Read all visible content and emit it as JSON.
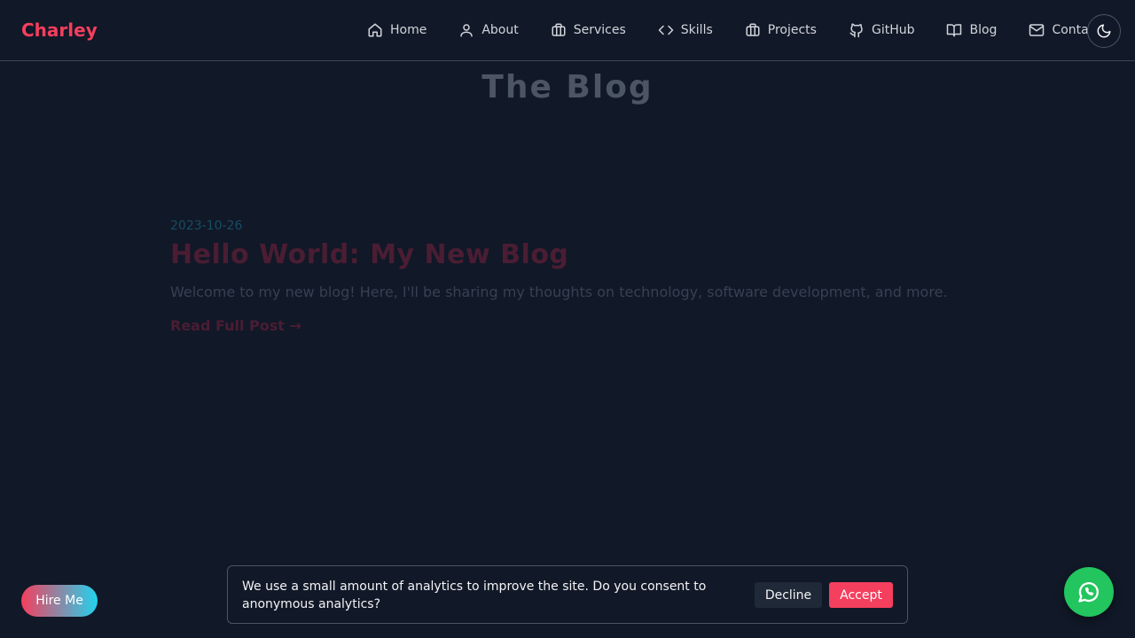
{
  "brand": "Charley",
  "nav": [
    {
      "label": "Home",
      "icon": "home-icon"
    },
    {
      "label": "About",
      "icon": "user-icon"
    },
    {
      "label": "Services",
      "icon": "briefcase-icon"
    },
    {
      "label": "Skills",
      "icon": "code-icon"
    },
    {
      "label": "Projects",
      "icon": "briefcase-icon"
    },
    {
      "label": "GitHub",
      "icon": "github-icon"
    },
    {
      "label": "Blog",
      "icon": "book-icon"
    },
    {
      "label": "Contact",
      "icon": "mail-icon"
    }
  ],
  "theme_toggle_icon": "moon-icon",
  "page_title": "The Blog",
  "post": {
    "date": "2023-10-26",
    "title": "Hello World: My New Blog",
    "excerpt": "Welcome to my new blog! Here, I'll be sharing my thoughts on technology, software development, and more.",
    "read_more": "Read Full Post →"
  },
  "hire_button": "Hire Me",
  "consent": {
    "text": "We use a small amount of analytics to improve the site. Do you consent to anonymous analytics?",
    "decline": "Decline",
    "accept": "Accept"
  },
  "whatsapp_icon": "whatsapp-icon",
  "colors": {
    "background": "#111827",
    "accent": "#f43f5e",
    "whatsapp": "#22c55e"
  }
}
